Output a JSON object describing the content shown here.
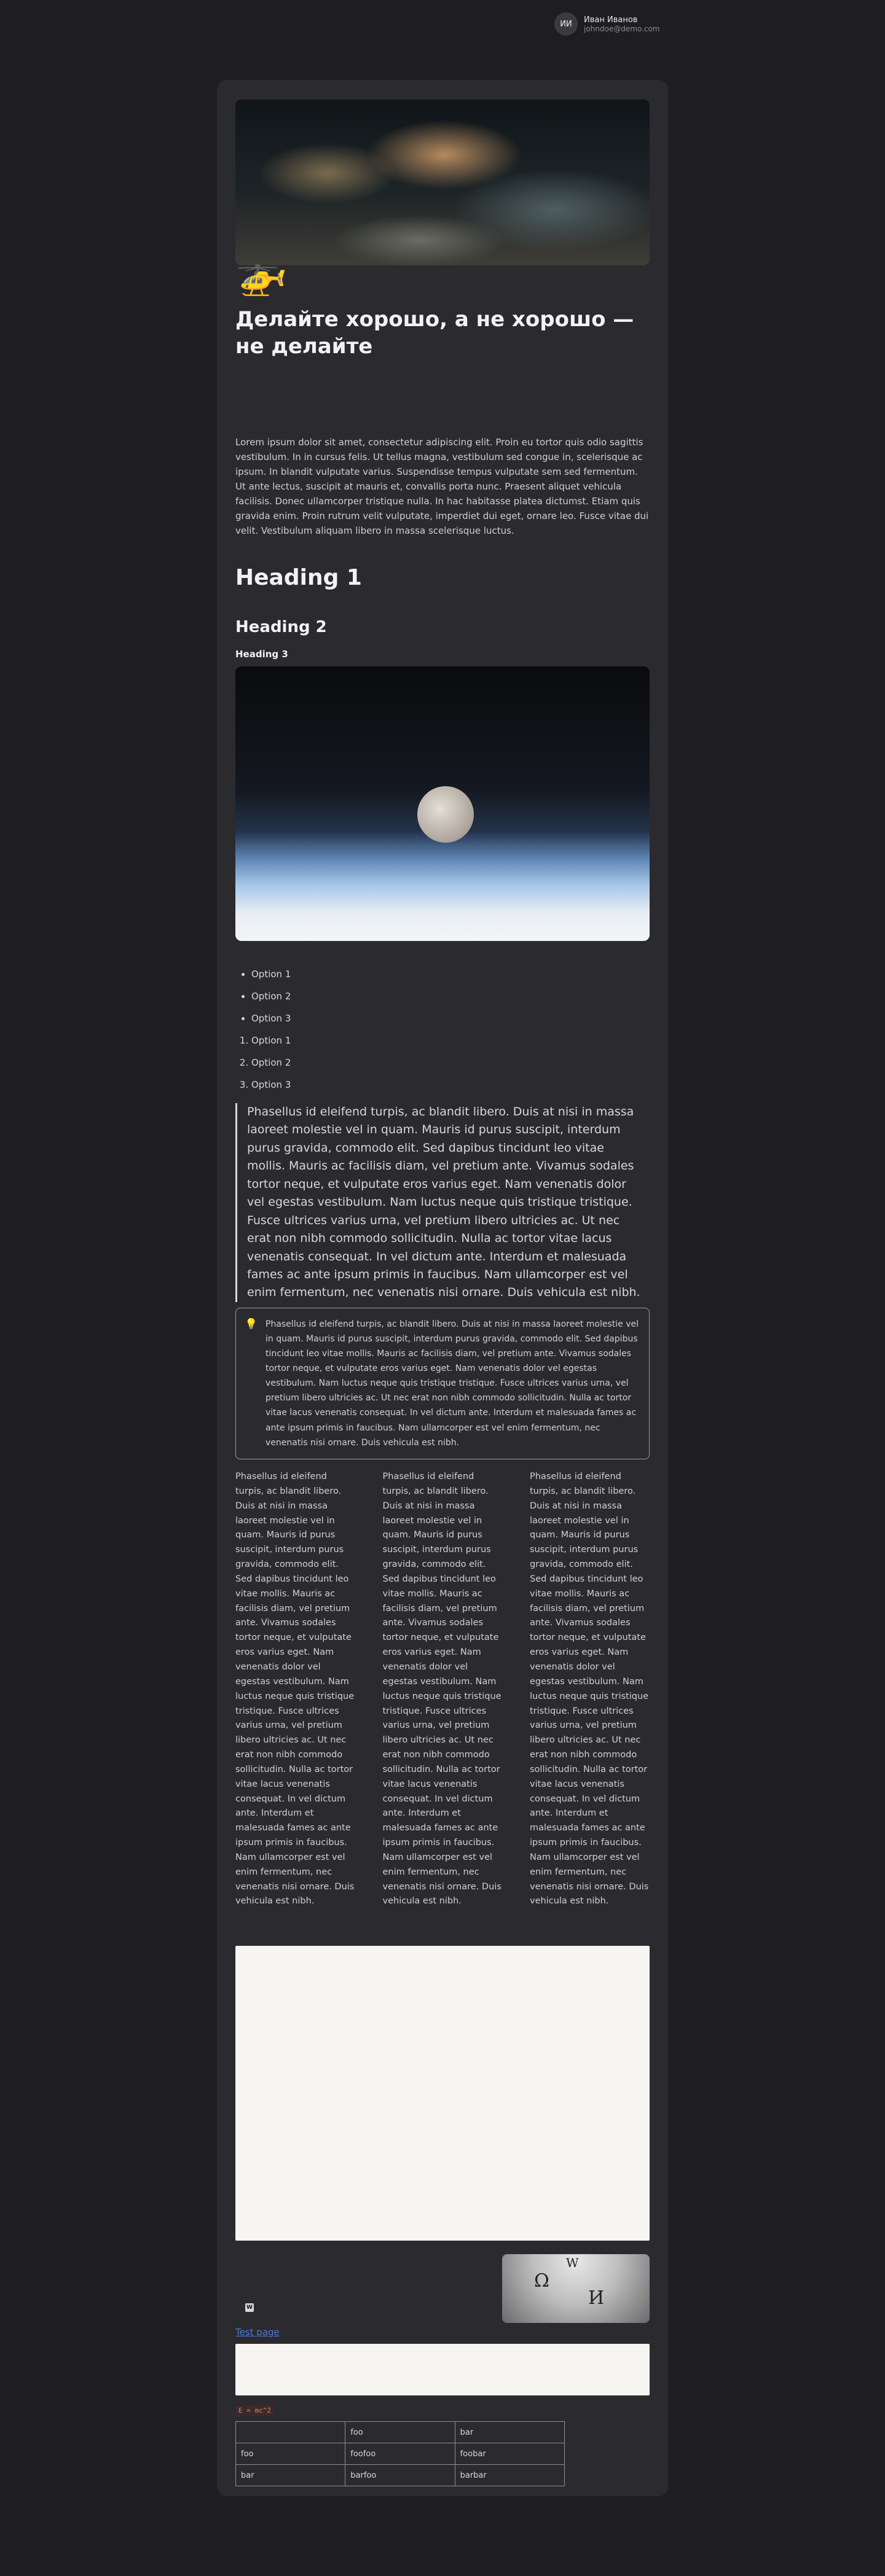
{
  "user": {
    "initials": "ИИ",
    "name": "Иван Иванов",
    "email": "johndoe@demo.com"
  },
  "page": {
    "icon": "🚁",
    "title": "Делайте хорошо, а не хорошо — не делайте"
  },
  "lorem": "Lorem ipsum dolor sit amet, consectetur adipiscing elit. Proin eu tortor quis odio sagittis vestibulum. In in cursus felis. Ut tellus magna, vestibulum sed congue in, scelerisque ac ipsum. In blandit vulputate varius. Suspendisse tempus vulputate sem sed fermentum. Ut ante lectus, suscipit at mauris et, convallis porta nunc. Praesent aliquet vehicula facilisis. Donec ullamcorper tristique nulla. In hac habitasse platea dictumst. Etiam quis gravida enim. Proin rutrum velit vulputate, imperdiet dui eget, ornare leo. Fusce vitae dui velit. Vestibulum aliquam libero in massa scelerisque luctus.",
  "headings": {
    "h1": "Heading 1",
    "h2": "Heading 2",
    "h3": "Heading 3"
  },
  "bullets": [
    "Option 1",
    "Option 2",
    "Option 3"
  ],
  "numbered": [
    "Option 1",
    "Option 2",
    "Option 3"
  ],
  "quote": "Phasellus id eleifend turpis, ac blandit libero. Duis at nisi in massa laoreet molestie vel in quam. Mauris id purus suscipit, interdum purus gravida, commodo elit. Sed dapibus tincidunt leo vitae mollis. Mauris ac facilisis diam, vel pretium ante. Vivamus sodales tortor neque, et vulputate eros varius eget. Nam venenatis dolor vel egestas vestibulum. Nam luctus neque quis tristique tristique. Fusce ultrices varius urna, vel pretium libero ultricies ac. Ut nec erat non nibh commodo sollicitudin. Nulla ac tortor vitae lacus venenatis consequat. In vel dictum ante. Interdum et malesuada fames ac ante ipsum primis in faucibus. Nam ullamcorper est vel enim fermentum, nec venenatis nisi ornare. Duis vehicula est nibh.",
  "callout": {
    "icon": "💡",
    "text": "Phasellus id eleifend turpis, ac blandit libero. Duis at nisi in massa laoreet molestie vel in quam. Mauris id purus suscipit, interdum purus gravida, commodo elit. Sed dapibus tincidunt leo vitae mollis. Mauris ac facilisis diam, vel pretium ante. Vivamus sodales tortor neque, et vulputate eros varius eget. Nam venenatis dolor vel egestas vestibulum. Nam luctus neque quis tristique tristique. Fusce ultrices varius urna, vel pretium libero ultricies ac. Ut nec erat non nibh commodo sollicitudin. Nulla ac tortor vitae lacus venenatis consequat. In vel dictum ante. Interdum et malesuada fames ac ante ipsum primis in faucibus. Nam ullamcorper est vel enim fermentum, nec venenatis nisi ornare. Duis vehicula est nibh."
  },
  "columns": [
    "Phasellus id eleifend turpis, ac blandit libero. Duis at nisi in massa laoreet molestie vel in quam. Mauris id purus suscipit, interdum purus gravida, commodo elit. Sed dapibus tincidunt leo vitae mollis. Mauris ac facilisis diam, vel pretium ante. Vivamus sodales tortor neque, et vulputate eros varius eget. Nam venenatis dolor vel egestas vestibulum. Nam luctus neque quis tristique tristique. Fusce ultrices varius urna, vel pretium libero ultricies ac. Ut nec erat non nibh commodo sollicitudin. Nulla ac tortor vitae lacus venenatis consequat. In vel dictum ante. Interdum et malesuada fames ac ante ipsum primis in faucibus. Nam ullamcorper est vel enim fermentum, nec venenatis nisi ornare. Duis vehicula est nibh.",
    "Phasellus id eleifend turpis, ac blandit libero. Duis at nisi in massa laoreet molestie vel in quam. Mauris id purus suscipit, interdum purus gravida, commodo elit. Sed dapibus tincidunt leo vitae mollis. Mauris ac facilisis diam, vel pretium ante. Vivamus sodales tortor neque, et vulputate eros varius eget. Nam venenatis dolor vel egestas vestibulum. Nam luctus neque quis tristique tristique. Fusce ultrices varius urna, vel pretium libero ultricies ac. Ut nec erat non nibh commodo sollicitudin. Nulla ac tortor vitae lacus venenatis consequat. In vel dictum ante. Interdum et malesuada fames ac ante ipsum primis in faucibus. Nam ullamcorper est vel enim fermentum, nec venenatis nisi ornare. Duis vehicula est nibh.",
    "Phasellus id eleifend turpis, ac blandit libero. Duis at nisi in massa laoreet molestie vel in quam. Mauris id purus suscipit, interdum purus gravida, commodo elit. Sed dapibus tincidunt leo vitae mollis. Mauris ac facilisis diam, vel pretium ante. Vivamus sodales tortor neque, et vulputate eros varius eget. Nam venenatis dolor vel egestas vestibulum. Nam luctus neque quis tristique tristique. Fusce ultrices varius urna, vel pretium libero ultricies ac. Ut nec erat non nibh commodo sollicitudin. Nulla ac tortor vitae lacus venenatis consequat. In vel dictum ante. Interdum et malesuada fames ac ante ipsum primis in faucibus. Nam ullamcorper est vel enim fermentum, nec venenatis nisi ornare. Duis vehicula est nibh."
  ],
  "bookmark": {
    "favicon": "W",
    "thumb_glyph_1": "Ω",
    "thumb_glyph_2": "И",
    "thumb_glyph_3": "W"
  },
  "link_text": "Test page",
  "equation": "E = mc^2",
  "table": {
    "rows": [
      [
        "",
        "foo",
        "bar"
      ],
      [
        "foo",
        "foofoo",
        "foobar"
      ],
      [
        "bar",
        "barfoo",
        "barbar"
      ]
    ]
  }
}
